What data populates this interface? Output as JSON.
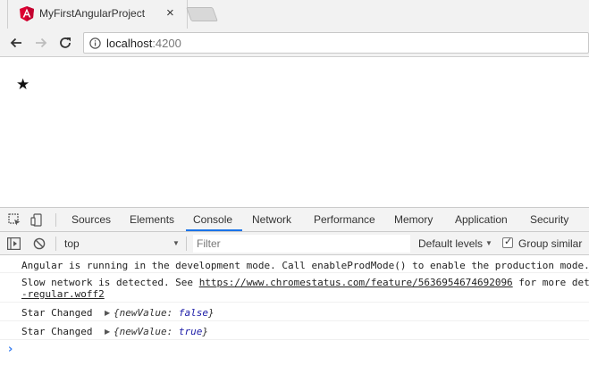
{
  "tab": {
    "title": "MyFirstAngularProject",
    "close": "×"
  },
  "address": {
    "host": "localhost",
    "port": ":4200"
  },
  "page": {
    "star": "★"
  },
  "devtools": {
    "tabs": [
      "Sources",
      "Elements",
      "Console",
      "Network",
      "Performance",
      "Memory",
      "Application",
      "Security"
    ],
    "active_tab": "Console",
    "context": "top",
    "filter_placeholder": "Filter",
    "levels": "Default levels",
    "group_similar": "Group similar",
    "group_similar_checked": true,
    "accent_color": "#1a73e8"
  },
  "console": {
    "angular_msg": "Angular is running in the development mode. Call enableProdMode() to enable the production mode.",
    "slow_prefix": "Slow network is detected. See ",
    "slow_link": "https://www.chromestatus.com/feature/5636954674692096",
    "slow_suffix": " for more deta",
    "slow_line2": "-regular.woff2",
    "star1_label": "Star Changed",
    "star1_open": "{",
    "star1_key": "newValue: ",
    "star1_value": "false",
    "star1_close": "}",
    "star2_label": "Star Changed",
    "star2_open": "{",
    "star2_key": "newValue: ",
    "star2_value": "true",
    "star2_close": "}",
    "prompt": "›"
  }
}
